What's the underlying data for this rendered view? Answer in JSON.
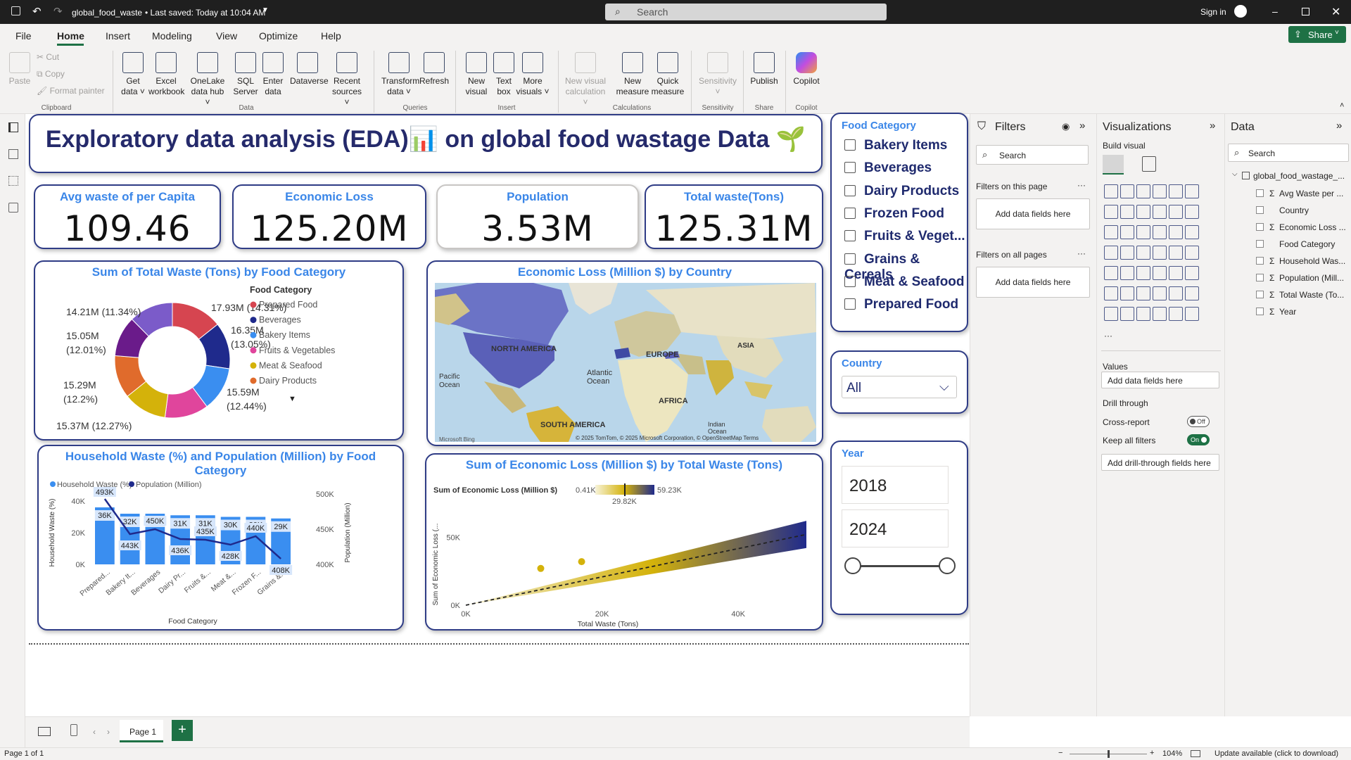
{
  "titlebar": {
    "file": "global_food_waste",
    "saved": "• Last saved: Today at 10:04 AM",
    "search": "Search",
    "signin": "Sign in",
    "share": "Share"
  },
  "menu": [
    "File",
    "Home",
    "Insert",
    "Modeling",
    "View",
    "Optimize",
    "Help"
  ],
  "ribbon": {
    "clipboard": {
      "paste": "Paste",
      "cut": "Cut",
      "copy": "Copy",
      "format": "Format painter",
      "group": "Clipboard"
    },
    "data": [
      {
        "l1": "Get",
        "l2": "data ˅"
      },
      {
        "l1": "Excel",
        "l2": "workbook"
      },
      {
        "l1": "OneLake",
        "l2": "data hub ˅"
      },
      {
        "l1": "SQL",
        "l2": "Server"
      },
      {
        "l1": "Enter",
        "l2": "data"
      },
      {
        "l1": "Dataverse",
        "l2": ""
      },
      {
        "l1": "Recent",
        "l2": "sources ˅"
      }
    ],
    "data_group": "Data",
    "queries": [
      {
        "l1": "Transform",
        "l2": "data ˅"
      },
      {
        "l1": "Refresh",
        "l2": ""
      }
    ],
    "queries_group": "Queries",
    "insert": [
      {
        "l1": "New",
        "l2": "visual"
      },
      {
        "l1": "Text",
        "l2": "box"
      },
      {
        "l1": "More",
        "l2": "visuals ˅"
      }
    ],
    "insert_group": "Insert",
    "calc": [
      {
        "l1": "New visual",
        "l2": "calculation ˅"
      },
      {
        "l1": "New",
        "l2": "measure"
      },
      {
        "l1": "Quick",
        "l2": "measure"
      }
    ],
    "calc_group": "Calculations",
    "sensitivity": {
      "l1": "Sensitivity",
      "l2": "˅",
      "group": "Sensitivity"
    },
    "share": {
      "l1": "Publish",
      "group": "Share"
    },
    "copilot": {
      "l1": "Copilot",
      "group": "Copilot"
    }
  },
  "report": {
    "title": "Exploratory data analysis (EDA)📊 on global food wastage Data 🌱",
    "kpis": [
      {
        "label": "Avg waste of per Capita",
        "value": "109.46"
      },
      {
        "label": "Economic Loss",
        "value": "125.20M"
      },
      {
        "label": "Population",
        "value": "3.53M"
      },
      {
        "label": "Total waste(Tons)",
        "value": "125.31M"
      }
    ],
    "donut_title": "Sum of Total Waste (Tons) by Food Category",
    "map_title": "Economic Loss (Million $) by Country",
    "combo_title": "Household Waste (%) and Population (Million) by Food Category",
    "scatter_title": "Sum of Economic Loss (Million $) by Total Waste (Tons)",
    "map": {
      "labels": [
        "NORTH AMERICA",
        "EUROPE",
        "ASIA",
        "AFRICA",
        "SOUTH AMERICA",
        "Atlantic",
        "Ocean",
        "Pacific",
        "Ocean",
        "Indian",
        "Ocean"
      ],
      "credit": "© 2025 TomTom, © 2025 Microsoft Corporation, © OpenStreetMap Terms",
      "bing": "Microsoft Bing"
    },
    "slicer_food": {
      "title": "Food Category",
      "items": [
        "Bakery Items",
        "Beverages",
        "Dairy Products",
        "Frozen Food",
        "Fruits & Veget...",
        "Grains & Cereals",
        "Meat & Seafood",
        "Prepared Food"
      ]
    },
    "slicer_country": {
      "title": "Country",
      "value": "All"
    },
    "slicer_year": {
      "title": "Year",
      "from": "2018",
      "to": "2024"
    }
  },
  "chart_data": [
    {
      "type": "pie",
      "title": "Sum of Total Waste (Tons) by Food Category",
      "legend_title": "Food Category",
      "legend_position": "right",
      "categories": [
        "Prepared Food",
        "Beverages",
        "Bakery Items",
        "Fruits & Vegetables",
        "Meat & Seafood",
        "Dairy Products",
        "Frozen Food",
        "Grains & Cereals"
      ],
      "legend_items": [
        "Prepared Food",
        "Beverages",
        "Bakery Items",
        "Fruits & Vegetables",
        "Meat & Seafood",
        "Dairy Products"
      ],
      "values": [
        17.93,
        16.35,
        15.59,
        15.37,
        15.29,
        15.05,
        14.21,
        15.52
      ],
      "value_labels": [
        "17.93M (14.31%)",
        "16.35M (13.05%)",
        "15.59M (12.44%)",
        "15.37M (12.27%)",
        "15.29M (12.2%)",
        "15.05M (12.01%)",
        "14.21M (11.34%)",
        ""
      ],
      "colors": [
        "#d64550",
        "#1f2a8c",
        "#3a8ef0",
        "#e0459c",
        "#d4b20a",
        "#e06b2c",
        "#6a1b8a",
        "#7b5bc9"
      ]
    },
    {
      "type": "bar",
      "title": "Household Waste (%) and Population (Million) by Food Category",
      "xlabel": "Food Category",
      "ylabel": "Household Waste (%)",
      "y2label": "Population (Million)",
      "categories": [
        "Prepared...",
        "Bakery It...",
        "Beverages",
        "Dairy Pr...",
        "Fruits &...",
        "Meat &...",
        "Frozen F...",
        "Grains &..."
      ],
      "ylim": [
        0,
        40000
      ],
      "yticks": [
        "0K",
        "20K",
        "40K"
      ],
      "y2lim": [
        400000,
        500000
      ],
      "y2ticks": [
        "400K",
        "450K",
        "500K"
      ],
      "series": [
        {
          "name": "Household Waste (%)",
          "values": [
            36000,
            32000,
            32000,
            31000,
            31000,
            30000,
            30000,
            29000
          ],
          "labels": [
            "36K",
            "32K",
            "32K",
            "31K",
            "31K",
            "30K",
            "30K",
            "29K"
          ],
          "color": "#3a8ef0"
        },
        {
          "name": "Population (Million)",
          "values": [
            493000,
            443000,
            450000,
            436000,
            435000,
            428000,
            440000,
            408000
          ],
          "labels": [
            "493K",
            "443K",
            "450K",
            "436K",
            "435K",
            "428K",
            "440K",
            "408K"
          ],
          "color": "#1f2a8c"
        }
      ]
    },
    {
      "type": "scatter",
      "title": "Sum of Economic Loss (Million $) by Total Waste (Tons)",
      "xlabel": "Total Waste (Tons)",
      "ylabel": "Sum of Economic Loss (...",
      "legend_title": "Sum of Economic Loss (Million $)",
      "color_min": "0.41K",
      "color_mid": "29.82K",
      "color_max": "59.23K",
      "xlim": [
        0,
        50000
      ],
      "xticks": [
        "0K",
        "20K",
        "40K"
      ],
      "ylim": [
        0,
        60000
      ],
      "yticks": [
        "0K",
        "50K"
      ],
      "outliers": [
        {
          "x": 11000,
          "y": 27000
        },
        {
          "x": 17000,
          "y": 32000
        }
      ],
      "band": {
        "x_start": 0,
        "x_end": 50000,
        "y_low_end": 42000,
        "y_high_end": 62000
      }
    }
  ],
  "filters": {
    "title": "Filters",
    "search": "Search",
    "on_page": "Filters on this page",
    "add_fields": "Add data fields here",
    "all_pages": "Filters on all pages",
    "dots": "···"
  },
  "viz": {
    "title": "Visualizations",
    "build": "Build visual",
    "values": "Values",
    "add_values": "Add data fields here",
    "drill": "Drill through",
    "cross": "Cross-report",
    "cross_state": "Off",
    "keep": "Keep all filters",
    "keep_state": "On",
    "add_drill": "Add drill-through fields here"
  },
  "data_pane": {
    "title": "Data",
    "search": "Search",
    "table": "global_food_wastage_...",
    "fields": [
      {
        "name": "Avg Waste per ...",
        "sigma": true
      },
      {
        "name": "Country",
        "sigma": false
      },
      {
        "name": "Economic Loss ...",
        "sigma": true
      },
      {
        "name": "Food Category",
        "sigma": false
      },
      {
        "name": "Household Was...",
        "sigma": true
      },
      {
        "name": "Population (Mill...",
        "sigma": true
      },
      {
        "name": "Total Waste (To...",
        "sigma": true
      },
      {
        "name": "Year",
        "sigma": true
      }
    ]
  },
  "pages": {
    "tab": "Page 1",
    "add": "+"
  },
  "status": {
    "page": "Page 1 of 1",
    "zoom": "104%",
    "update": "Update available (click to download)"
  },
  "colors": {
    "accent": "#3a86e8",
    "border": "#2f3c86",
    "dark": "#1f2a6e",
    "share": "#1e7145"
  }
}
